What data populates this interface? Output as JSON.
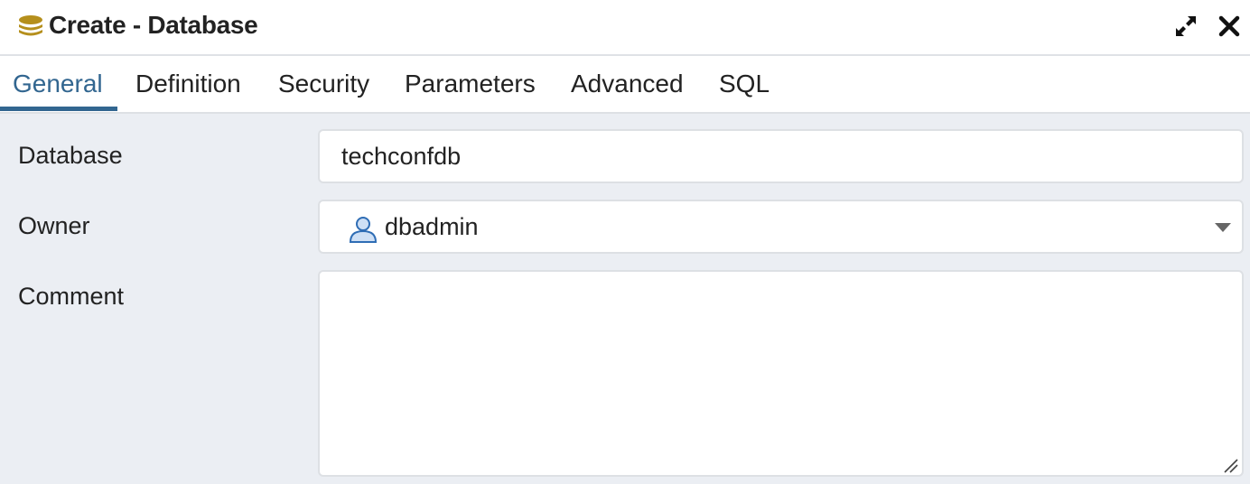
{
  "dialog": {
    "title": "Create - Database",
    "icon": "database-icon",
    "expand_icon": "expand-icon",
    "close_icon": "close-icon"
  },
  "tabs": [
    {
      "label": "General",
      "active": true
    },
    {
      "label": "Definition",
      "active": false
    },
    {
      "label": "Security",
      "active": false
    },
    {
      "label": "Parameters",
      "active": false
    },
    {
      "label": "Advanced",
      "active": false
    },
    {
      "label": "SQL",
      "active": false
    }
  ],
  "form": {
    "database": {
      "label": "Database",
      "value": "techconfdb"
    },
    "owner": {
      "label": "Owner",
      "value": "dbadmin",
      "icon": "user-icon"
    },
    "comment": {
      "label": "Comment",
      "value": ""
    }
  },
  "colors": {
    "accent": "#326690",
    "database_icon": "#b58f1c",
    "user_icon": "#2f6db5",
    "panel_background": "#ebeef3"
  }
}
